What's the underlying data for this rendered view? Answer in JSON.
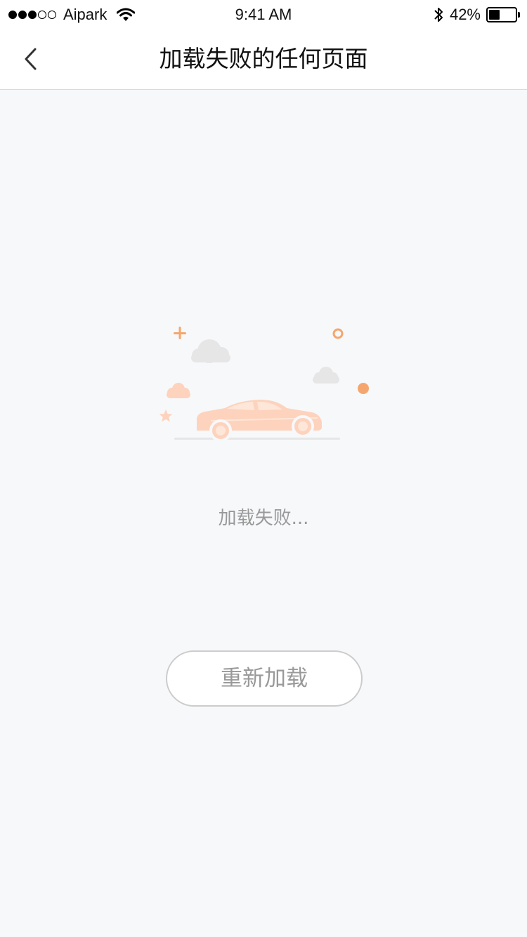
{
  "status_bar": {
    "carrier": "Aipark",
    "signal_bars_filled": 3,
    "signal_bars_total": 5,
    "time": "9:41 AM",
    "battery_percent": "42%",
    "battery_level": 0.42,
    "icons": [
      "signal-icon",
      "wifi-icon",
      "bluetooth-icon",
      "battery-icon"
    ]
  },
  "nav": {
    "back_icon": "chevron-left-icon",
    "title": "加载失败的任何页面"
  },
  "empty_state": {
    "illustration": "car-with-clouds-illustration",
    "message": "加载失败...",
    "reload_label": "重新加载"
  },
  "colors": {
    "background": "#f7f8fa",
    "accent_orange": "#f5a66e",
    "car_peach": "#fdd3bd",
    "cloud_gray": "#e6e6e6",
    "muted_text": "#999999",
    "button_border": "#cccccc"
  }
}
